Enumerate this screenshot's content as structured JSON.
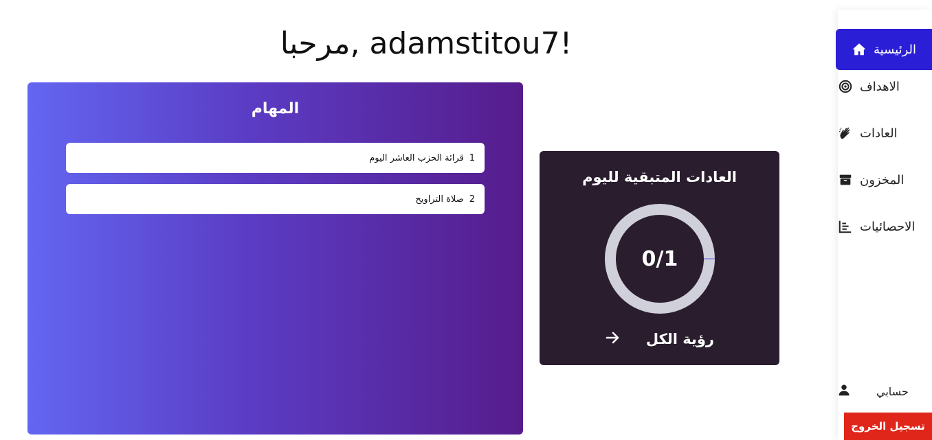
{
  "greeting": "مرحبا, adamstitou7!",
  "sidebar": {
    "items": [
      {
        "label": "الرئيسية",
        "icon": "home-icon",
        "active": true
      },
      {
        "label": "الاهداف",
        "icon": "target-icon"
      },
      {
        "label": "العادات",
        "icon": "hands-clapping-icon"
      },
      {
        "label": "المخزون",
        "icon": "box-icon"
      },
      {
        "label": "الاحصائيات",
        "icon": "stats-list-icon"
      }
    ],
    "account_label": "حسابي",
    "account_icon": "user-icon",
    "logout_label": "تسجيل الخروج"
  },
  "tasks": {
    "title": "المهام",
    "items": [
      {
        "number": "1",
        "text": "قرائة الحزب العاشر اليوم"
      },
      {
        "number": "2",
        "text": "صلاة التراويح"
      }
    ]
  },
  "habits": {
    "title": "العادات المتبقية لليوم",
    "progress_text": "0/1",
    "completed": 0,
    "total": 1,
    "see_all_label": "رؤية الكل",
    "see_all_icon": "arrow-right-icon"
  },
  "colors": {
    "accent": "#2a1ed6",
    "logout": "#e0261a",
    "habits_card": "#2a1d2e",
    "ring": "#d0d0db"
  }
}
